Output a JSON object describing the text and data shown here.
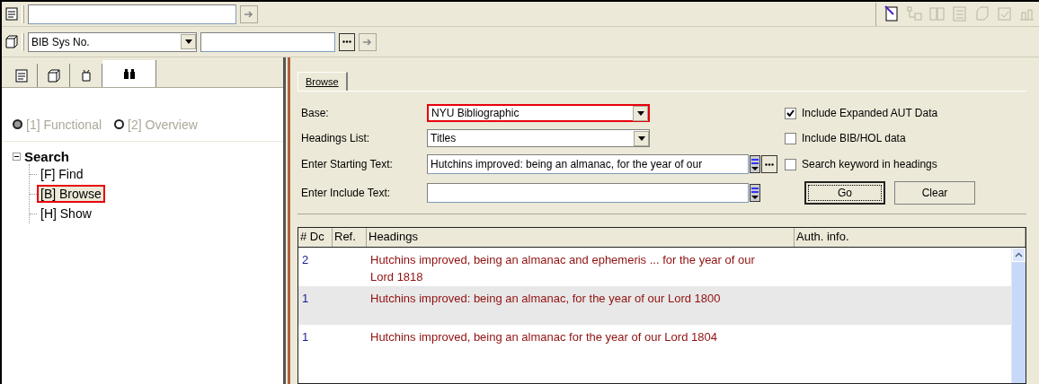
{
  "top_bar": {
    "toolbar_icons": [
      {
        "disabled": false
      },
      {
        "disabled": true
      },
      {
        "disabled": true
      },
      {
        "disabled": true
      },
      {
        "disabled": true
      },
      {
        "disabled": true
      },
      {
        "disabled": true
      }
    ]
  },
  "search_bar": {
    "field_choice": "BIB Sys No."
  },
  "left_panel": {
    "tabs": [
      {
        "selected": false
      },
      {
        "selected": false
      },
      {
        "selected": false
      },
      {
        "selected": true
      }
    ],
    "modes": [
      {
        "label": "[1] Functional",
        "selected": true
      },
      {
        "label": "[2] Overview",
        "selected": false
      }
    ],
    "tree": [
      {
        "label": "Search",
        "expanded": true,
        "children": [
          {
            "label": "[F] Find",
            "selected": false
          },
          {
            "label": "[B] Browse",
            "selected": true
          },
          {
            "label": "[H] Show",
            "selected": false
          }
        ]
      }
    ]
  },
  "browse": {
    "tab": {
      "label": "Browse",
      "selected": true
    },
    "base": {
      "label": "Base:",
      "value": "NYU Bibliographic",
      "highlighted": true
    },
    "headings_list": {
      "label": "Headings List:",
      "value": "Titles"
    },
    "starting_text": {
      "label": "Enter Starting Text:",
      "value": "Hutchins improved: being an almanac, for the year of our"
    },
    "include_text": {
      "label": "Enter Include Text:"
    },
    "options": [
      {
        "label": "Include Expanded AUT Data",
        "checked": true
      },
      {
        "label": "Include BIB/HOL data",
        "checked": false
      }
    ],
    "keyword_option": {
      "label": "Search keyword in headings",
      "checked": false
    },
    "buttons": [
      {
        "label": "Go",
        "default": true
      },
      {
        "label": "Clear",
        "default": false
      }
    ],
    "table": {
      "columns": [
        "# Dc",
        "Ref.",
        "Headings",
        "Auth. info."
      ],
      "rows": [
        {
          "docs": "2",
          "heading": "Hutchins improved, being an almanac and ephemeris ... for the year of our Lord 1818"
        },
        {
          "docs": "1",
          "heading": "Hutchins improved: being an almanac, for the year of our Lord 1800"
        },
        {
          "docs": "1",
          "heading": "Hutchins improved, being an almanac for the year of our Lord 1804"
        }
      ]
    }
  }
}
